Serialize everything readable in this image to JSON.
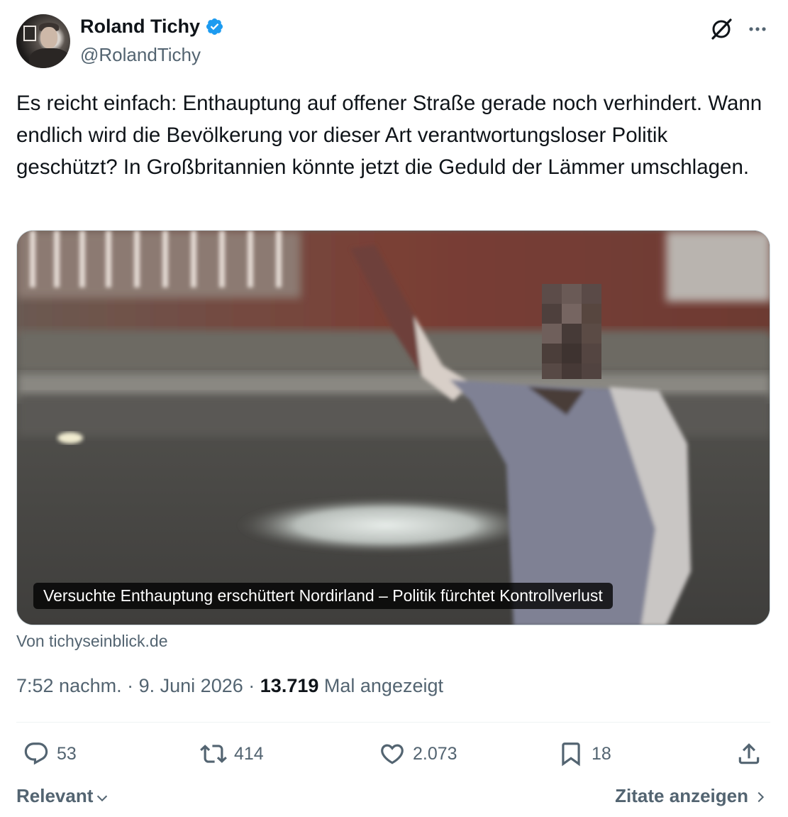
{
  "author": {
    "display_name": "Roland Tichy",
    "handle": "@RolandTichy",
    "verified": true
  },
  "tweet": {
    "text": "Es reicht einfach: Enthauptung auf offener Straße gerade noch verhindert. Wann endlich wird die Bevölkerung vor dieser Art verantwortungsloser Politik geschützt? In Großbritannien könnte jetzt die Geduld der Lämmer umschlagen."
  },
  "card": {
    "caption": "Versuchte Enthauptung erschüttert Nordirland – Politik fürchtet Kontrollverlust",
    "source": "Von tichyseinblick.de"
  },
  "meta": {
    "time": "7:52 nachm.",
    "separator": "·",
    "date": "9. Juni 2026",
    "views": "13.719",
    "views_label": "Mal angezeigt"
  },
  "actions": {
    "replies": "53",
    "reposts": "414",
    "likes": "2.073",
    "bookmarks": "18"
  },
  "footer": {
    "sort_label": "Relevant",
    "quotes_label": "Zitate anzeigen"
  },
  "colors": {
    "text": "#0f1419",
    "secondary": "#536471",
    "verified": "#1d9bf0",
    "border": "#cfd9de"
  },
  "icons": [
    "verified-badge-icon",
    "grok-icon",
    "more-icon",
    "reply-icon",
    "repost-icon",
    "like-icon",
    "bookmark-icon",
    "share-icon",
    "chevron-down-icon",
    "chevron-right-icon"
  ]
}
